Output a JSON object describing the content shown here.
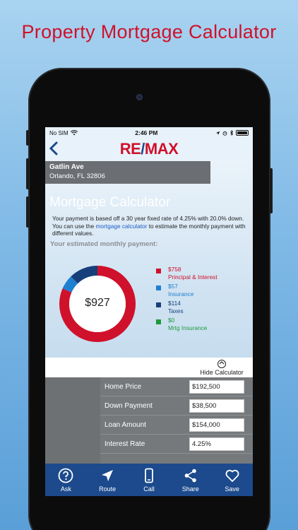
{
  "headline": "Property Mortgage Calculator",
  "status": {
    "carrier": "No SIM",
    "time": "2:46 PM"
  },
  "nav": {
    "back_symbol": "‹",
    "logo_re": "RE",
    "logo_slash": "/",
    "logo_max": "MAX"
  },
  "address": {
    "street": "Gatlin Ave",
    "city": "Orlando, FL 32806"
  },
  "calculator": {
    "title": "Mortgage Calculator",
    "desc_before": "Your payment is based off a 30 year fixed rate of 4.25% with 20.0% down. You can use the ",
    "desc_link": "mortgage calculator",
    "desc_after": " to estimate the monthly payment with different values.",
    "estimate_label": "Your estimated monthly payment:",
    "total": "$927",
    "legend": [
      {
        "amount": "$758",
        "label": "Principal & Interest",
        "color": "#d0112b"
      },
      {
        "amount": "$57",
        "label": "Insurance",
        "color": "#1f7fd1"
      },
      {
        "amount": "$114",
        "label": "Taxes",
        "color": "#173f7a"
      },
      {
        "amount": "$0",
        "label": "Mrtg Insurance",
        "color": "#1e9a3c"
      }
    ],
    "hide_label": "Hide Calculator"
  },
  "form": {
    "rows": [
      {
        "label": "Home Price",
        "value": "$192,500"
      },
      {
        "label": "Down Payment",
        "value": "$38,500"
      },
      {
        "label": "Loan Amount",
        "value": "$154,000"
      },
      {
        "label": "Interest Rate",
        "value": "4.25%"
      }
    ]
  },
  "tabs": [
    {
      "label": "Ask",
      "icon": "question-icon"
    },
    {
      "label": "Route",
      "icon": "navigation-arrow-icon"
    },
    {
      "label": "Call",
      "icon": "phone-icon"
    },
    {
      "label": "Share",
      "icon": "share-icon"
    },
    {
      "label": "Save",
      "icon": "heart-icon"
    }
  ],
  "colors": {
    "brand_red": "#d0112b",
    "brand_blue": "#1c4a8c"
  }
}
